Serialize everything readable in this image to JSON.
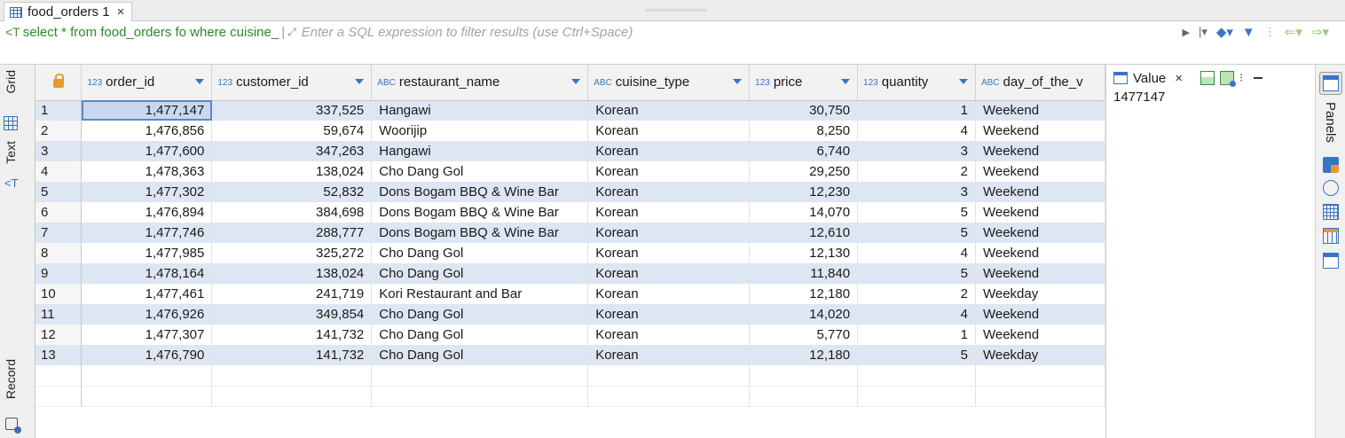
{
  "tab": {
    "title": "food_orders 1",
    "close": "×"
  },
  "filter": {
    "query": "select * from food_orders fo where cuisine_",
    "placeholder": "Enter a SQL expression to filter results (use Ctrl+Space)"
  },
  "side_tabs": {
    "grid": "Grid",
    "text": "Text",
    "record": "Record"
  },
  "columns": [
    {
      "type": "123",
      "name": "order_id"
    },
    {
      "type": "123",
      "name": "customer_id"
    },
    {
      "type": "ABC",
      "name": "restaurant_name"
    },
    {
      "type": "ABC",
      "name": "cuisine_type"
    },
    {
      "type": "123",
      "name": "price"
    },
    {
      "type": "123",
      "name": "quantity"
    },
    {
      "type": "ABC",
      "name": "day_of_the_v"
    }
  ],
  "rows": [
    [
      "1",
      "1,477,147",
      "337,525",
      "Hangawi",
      "Korean",
      "30,750",
      "1",
      "Weekend"
    ],
    [
      "2",
      "1,476,856",
      "59,674",
      "Woorijip",
      "Korean",
      "8,250",
      "4",
      "Weekend"
    ],
    [
      "3",
      "1,477,600",
      "347,263",
      "Hangawi",
      "Korean",
      "6,740",
      "3",
      "Weekend"
    ],
    [
      "4",
      "1,478,363",
      "138,024",
      "Cho Dang Gol",
      "Korean",
      "29,250",
      "2",
      "Weekend"
    ],
    [
      "5",
      "1,477,302",
      "52,832",
      "Dons Bogam BBQ & Wine Bar",
      "Korean",
      "12,230",
      "3",
      "Weekend"
    ],
    [
      "6",
      "1,476,894",
      "384,698",
      "Dons Bogam BBQ & Wine Bar",
      "Korean",
      "14,070",
      "5",
      "Weekend"
    ],
    [
      "7",
      "1,477,746",
      "288,777",
      "Dons Bogam BBQ & Wine Bar",
      "Korean",
      "12,610",
      "5",
      "Weekend"
    ],
    [
      "8",
      "1,477,985",
      "325,272",
      "Cho Dang Gol",
      "Korean",
      "12,130",
      "4",
      "Weekend"
    ],
    [
      "9",
      "1,478,164",
      "138,024",
      "Cho Dang Gol",
      "Korean",
      "11,840",
      "5",
      "Weekend"
    ],
    [
      "10",
      "1,477,461",
      "241,719",
      "Kori Restaurant and Bar",
      "Korean",
      "12,180",
      "2",
      "Weekday"
    ],
    [
      "11",
      "1,476,926",
      "349,854",
      "Cho Dang Gol",
      "Korean",
      "14,020",
      "4",
      "Weekend"
    ],
    [
      "12",
      "1,477,307",
      "141,732",
      "Cho Dang Gol",
      "Korean",
      "5,770",
      "1",
      "Weekend"
    ],
    [
      "13",
      "1,476,790",
      "141,732",
      "Cho Dang Gol",
      "Korean",
      "12,180",
      "5",
      "Weekday"
    ]
  ],
  "value_panel": {
    "title": "Value",
    "close": "×",
    "value": "1477147"
  },
  "right_panel": {
    "label": "Panels"
  },
  "colors": {
    "accent": "#3a74c4",
    "alt_row": "#dde6f2",
    "sql": "#2c8a2c"
  }
}
